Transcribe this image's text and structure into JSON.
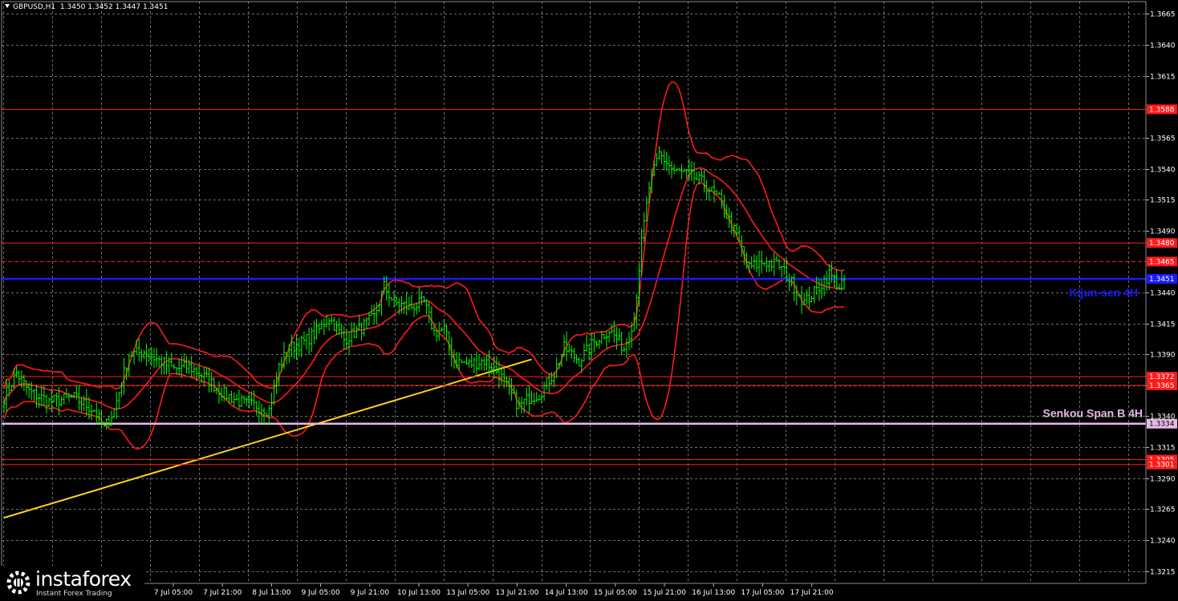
{
  "header": {
    "symbol": "GBPUSD,H1",
    "ohlc": "1.3450 1.3452 1.3447 1.3451"
  },
  "watermark": {
    "brand": "instaforex",
    "tagline": "Instant Forex Trading"
  },
  "chart_data": {
    "type": "candlestick",
    "timeframe": "H1",
    "ylim": [
      1.3205,
      1.3675
    ],
    "y_ticks": [
      "1.3665",
      "1.3640",
      "1.3615",
      "1.3565",
      "1.3540",
      "1.3515",
      "1.3490",
      "1.3440",
      "1.3415",
      "1.3390",
      "1.3365",
      "1.3340",
      "1.3315",
      "1.3290",
      "1.3265",
      "1.3240",
      "1.3215"
    ],
    "x_ticks": [
      "7 Jul 05:00",
      "7 Jul 21:00",
      "8 Jul 13:00",
      "9 Jul 05:00",
      "9 Jul 21:00",
      "10 Jul 13:00",
      "13 Jul 05:00",
      "13 Jul 21:00",
      "14 Jul 13:00",
      "15 Jul 05:00",
      "15 Jul 21:00",
      "16 Jul 13:00",
      "17 Jul 05:00",
      "17 Jul 21:00"
    ],
    "horizontal_levels": [
      {
        "value": 1.3588,
        "label": "1.3588",
        "color": "#ff1a1a"
      },
      {
        "value": 1.348,
        "label": "1.3480",
        "color": "#ff1a1a"
      },
      {
        "value": 1.3465,
        "label": "1.3465",
        "color": "#ff1a1a",
        "style": "dashed"
      },
      {
        "value": 1.3372,
        "label": "1.3372",
        "color": "#ff1a1a"
      },
      {
        "value": 1.3365,
        "label": "1.3365",
        "color": "#ff1a1a"
      },
      {
        "value": 1.3305,
        "label": "1.3305",
        "color": "#ff1a1a"
      },
      {
        "value": 1.3301,
        "label": "1.3301",
        "color": "#ff1a1a"
      }
    ],
    "kijun_sen_4h": {
      "value": 1.3451,
      "label": "1.3451",
      "color": "#1a1aff",
      "name": "Kijun-sen 4H"
    },
    "senkou_span_b_4h": {
      "value": 1.3334,
      "label": "1.3334",
      "color": "#e6b8e6",
      "name": "Senkou Span B 4H"
    },
    "trendline": {
      "from": {
        "bar": 0,
        "price": 1.3258
      },
      "to": {
        "bar": 211,
        "price": 1.3386
      },
      "color": "#ffd21a"
    },
    "bollinger_color": "#ff1a1a",
    "candle_color": "#00ff00",
    "grid": true,
    "close_waypoints": [
      [
        0,
        1.3355
      ],
      [
        5,
        1.3375
      ],
      [
        10,
        1.336
      ],
      [
        18,
        1.3352
      ],
      [
        28,
        1.3355
      ],
      [
        36,
        1.3345
      ],
      [
        40,
        1.333
      ],
      [
        44,
        1.3345
      ],
      [
        50,
        1.339
      ],
      [
        56,
        1.3392
      ],
      [
        62,
        1.3385
      ],
      [
        68,
        1.3378
      ],
      [
        74,
        1.338
      ],
      [
        80,
        1.3372
      ],
      [
        88,
        1.3358
      ],
      [
        96,
        1.335
      ],
      [
        102,
        1.3348
      ],
      [
        106,
        1.3345
      ],
      [
        110,
        1.338
      ],
      [
        114,
        1.3395
      ],
      [
        120,
        1.34
      ],
      [
        126,
        1.341
      ],
      [
        130,
        1.342
      ],
      [
        136,
        1.3402
      ],
      [
        142,
        1.341
      ],
      [
        148,
        1.342
      ],
      [
        152,
        1.3445
      ],
      [
        156,
        1.3432
      ],
      [
        162,
        1.3428
      ],
      [
        168,
        1.3432
      ],
      [
        172,
        1.3408
      ],
      [
        176,
        1.341
      ],
      [
        180,
        1.3385
      ],
      [
        186,
        1.3382
      ],
      [
        192,
        1.3385
      ],
      [
        198,
        1.3375
      ],
      [
        202,
        1.336
      ],
      [
        206,
        1.3348
      ],
      [
        210,
        1.3355
      ],
      [
        214,
        1.3358
      ],
      [
        220,
        1.3375
      ],
      [
        224,
        1.3395
      ],
      [
        230,
        1.3385
      ],
      [
        236,
        1.34
      ],
      [
        242,
        1.341
      ],
      [
        248,
        1.3395
      ],
      [
        252,
        1.342
      ],
      [
        255,
        1.348
      ],
      [
        258,
        1.3525
      ],
      [
        262,
        1.3552
      ],
      [
        268,
        1.3538
      ],
      [
        274,
        1.3535
      ],
      [
        280,
        1.3528
      ],
      [
        286,
        1.3515
      ],
      [
        292,
        1.349
      ],
      [
        298,
        1.346
      ],
      [
        304,
        1.3465
      ],
      [
        310,
        1.3462
      ],
      [
        316,
        1.3445
      ],
      [
        320,
        1.3432
      ],
      [
        325,
        1.3442
      ],
      [
        330,
        1.3455
      ],
      [
        332,
        1.345
      ],
      [
        334,
        1.3445
      ],
      [
        336,
        1.3451
      ]
    ]
  }
}
